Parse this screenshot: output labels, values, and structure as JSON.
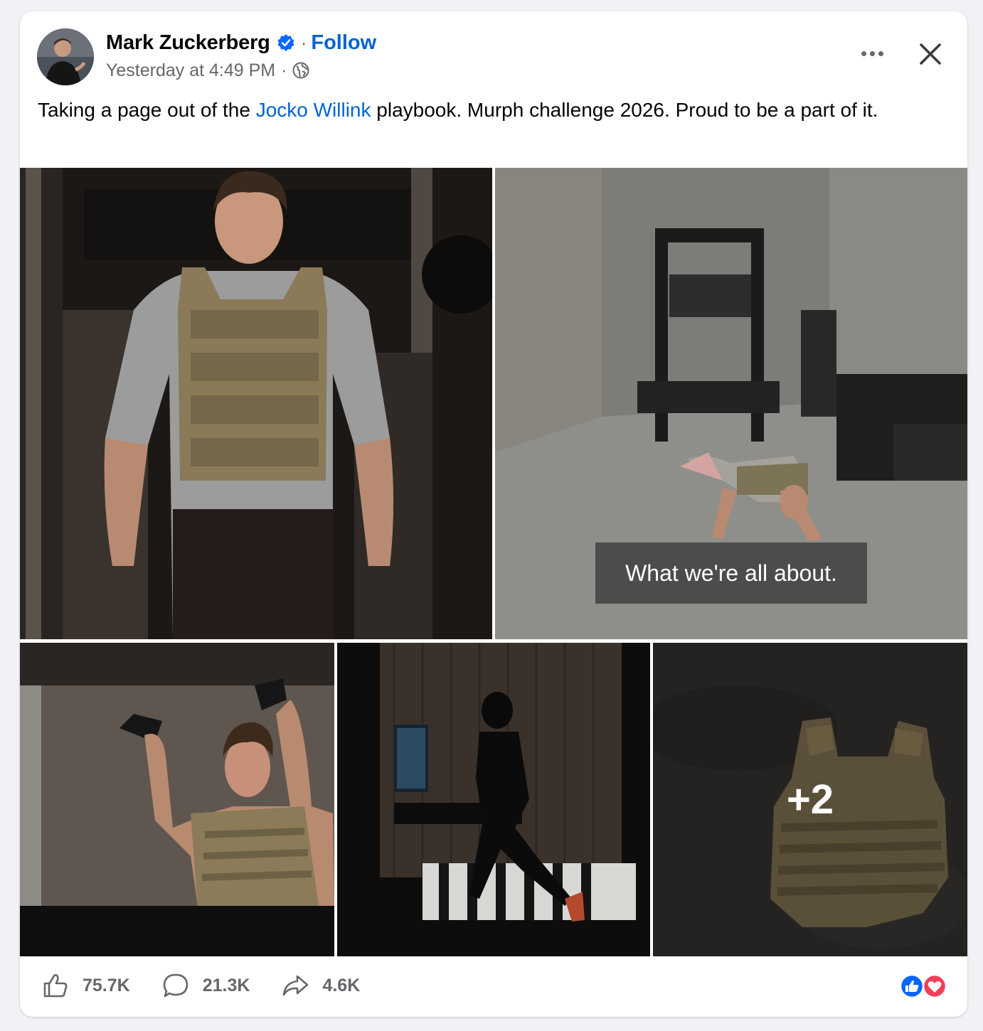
{
  "post": {
    "author": "Mark Zuckerberg",
    "verified": true,
    "separator": "·",
    "follow_label": "Follow",
    "timestamp": "Yesterday at 4:49 PM",
    "text_before": "Taking a page out of the ",
    "mention": "Jocko Willink",
    "text_after": " playbook. Murph challenge 2026. Proud to be a part of it."
  },
  "media": {
    "video_caption": "What we're all about.",
    "more_count": "+2"
  },
  "footer": {
    "likes": "75.7K",
    "comments": "21.3K",
    "shares": "4.6K"
  },
  "colors": {
    "link_blue": "#0064d1",
    "verified_blue": "#0866ff",
    "love_red": "#f33e58",
    "muted_text": "#65676b"
  },
  "icons": [
    "verified-badge-icon",
    "globe-icon",
    "more-icon",
    "close-icon",
    "like-icon",
    "comment-icon",
    "share-icon",
    "like-reaction-icon",
    "love-reaction-icon"
  ]
}
